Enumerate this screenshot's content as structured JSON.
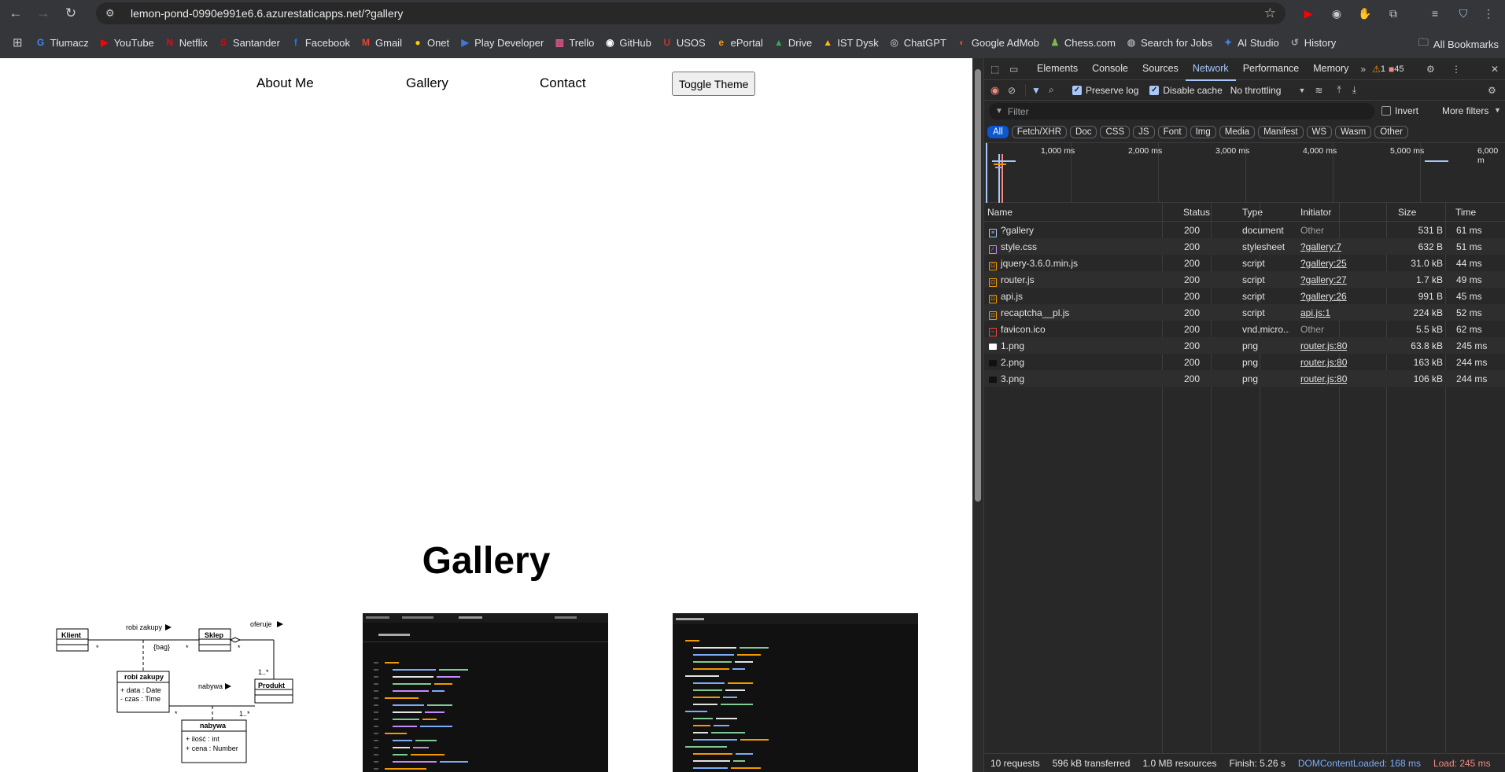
{
  "browser": {
    "url": "lemon-pond-0990e991e6.6.azurestaticapps.net/?gallery",
    "bookmarks": [
      {
        "label": "Tłumacz",
        "color": "#4285f4",
        "glyph": "G"
      },
      {
        "label": "YouTube",
        "color": "#ff0000",
        "glyph": "▶"
      },
      {
        "label": "Netflix",
        "color": "#e50914",
        "glyph": "N"
      },
      {
        "label": "Santander",
        "color": "#ec0000",
        "glyph": "S"
      },
      {
        "label": "Facebook",
        "color": "#1877f2",
        "glyph": "f"
      },
      {
        "label": "Gmail",
        "color": "#ea4335",
        "glyph": "M"
      },
      {
        "label": "Onet",
        "color": "#ffcc00",
        "glyph": "●"
      },
      {
        "label": "Play Developer",
        "color": "#3c78d8",
        "glyph": "▶"
      },
      {
        "label": "Trello",
        "color": "#f05a8e",
        "glyph": "▥"
      },
      {
        "label": "GitHub",
        "color": "#ffffff",
        "glyph": "◉"
      },
      {
        "label": "USOS",
        "color": "#c0392b",
        "glyph": "U"
      },
      {
        "label": "ePortal",
        "color": "#f39c12",
        "glyph": "e"
      },
      {
        "label": "Drive",
        "color": "#34a853",
        "glyph": "▲"
      },
      {
        "label": "IST Dysk",
        "color": "#fbbc04",
        "glyph": "▲"
      },
      {
        "label": "ChatGPT",
        "color": "#9aa0a6",
        "glyph": "◎"
      },
      {
        "label": "Google AdMob",
        "color": "#ea4335",
        "glyph": "◐"
      },
      {
        "label": "Chess.com",
        "color": "#81b64c",
        "glyph": "♟"
      },
      {
        "label": "Search for Jobs",
        "color": "#9aa0a6",
        "glyph": "◍"
      },
      {
        "label": "AI Studio",
        "color": "#4285f4",
        "glyph": "✦"
      },
      {
        "label": "History",
        "color": "#9aa0a6",
        "glyph": "↺"
      }
    ],
    "all_bookmarks": "All Bookmarks"
  },
  "page": {
    "nav": {
      "about": "About Me",
      "gallery": "Gallery",
      "contact": "Contact"
    },
    "toggle_theme": "Toggle Theme",
    "gallery_title": "Gallery",
    "uml": {
      "klient": "Klient",
      "sklep": "Sklep",
      "produkt": "Produkt",
      "robi_zakupy_class": "robi zakupy",
      "nabywa_class": "nabywa",
      "robi_zakupy_label": "robi zakupy",
      "oferuje": "oferuje",
      "nabywa_label": "nabywa",
      "bag": "{bag}",
      "star": "*",
      "one_many": "1..*",
      "attr_data": "+ data : Date",
      "attr_czas": "- czas : Time",
      "attr_ilosc": "+ ilość : int",
      "attr_cena": "+ cena : Number"
    }
  },
  "devtools": {
    "tabs": [
      "Elements",
      "Console",
      "Sources",
      "Network",
      "Performance",
      "Memory"
    ],
    "active_tab": "Network",
    "warnings": "1",
    "errors": "45",
    "preserve_log": "Preserve log",
    "disable_cache": "Disable cache",
    "throttling": "No throttling",
    "filter_placeholder": "Filter",
    "invert": "Invert",
    "more_filters": "More filters",
    "type_filters": [
      "All",
      "Fetch/XHR",
      "Doc",
      "CSS",
      "JS",
      "Font",
      "Img",
      "Media",
      "Manifest",
      "WS",
      "Wasm",
      "Other"
    ],
    "timeline_ticks": [
      "1,000 ms",
      "2,000 ms",
      "3,000 ms",
      "4,000 ms",
      "5,000 ms",
      "6,000 m"
    ],
    "columns": {
      "name": "Name",
      "status": "Status",
      "type": "Type",
      "initiator": "Initiator",
      "size": "Size",
      "time": "Time"
    },
    "requests": [
      {
        "name": "?gallery",
        "status": "200",
        "type": "document",
        "initiator": "Other",
        "initiator_link": false,
        "size": "531 B",
        "time": "61 ms",
        "icon": "doc",
        "color": "#a8c7fa"
      },
      {
        "name": "style.css",
        "status": "200",
        "type": "stylesheet",
        "initiator": "?gallery:7",
        "initiator_link": true,
        "size": "632 B",
        "time": "51 ms",
        "icon": "css",
        "color": "#c58af9"
      },
      {
        "name": "jquery-3.6.0.min.js",
        "status": "200",
        "type": "script",
        "initiator": "?gallery:25",
        "initiator_link": true,
        "size": "31.0 kB",
        "time": "44 ms",
        "icon": "js",
        "color": "#f29900"
      },
      {
        "name": "router.js",
        "status": "200",
        "type": "script",
        "initiator": "?gallery:27",
        "initiator_link": true,
        "size": "1.7 kB",
        "time": "49 ms",
        "icon": "js",
        "color": "#f29900"
      },
      {
        "name": "api.js",
        "status": "200",
        "type": "script",
        "initiator": "?gallery:26",
        "initiator_link": true,
        "size": "991 B",
        "time": "45 ms",
        "icon": "js",
        "color": "#f29900"
      },
      {
        "name": "recaptcha__pl.js",
        "status": "200",
        "type": "script",
        "initiator": "api.js:1",
        "initiator_link": true,
        "size": "224 kB",
        "time": "52 ms",
        "icon": "js",
        "color": "#f29900"
      },
      {
        "name": "favicon.ico",
        "status": "200",
        "type": "vnd.micro...",
        "initiator": "Other",
        "initiator_link": false,
        "size": "5.5 kB",
        "time": "62 ms",
        "icon": "ico",
        "color": "#e8453c"
      },
      {
        "name": "1.png",
        "status": "200",
        "type": "png",
        "initiator": "router.js:80",
        "initiator_link": true,
        "size": "63.8 kB",
        "time": "245 ms",
        "icon": "img",
        "color": "#ffffff"
      },
      {
        "name": "2.png",
        "status": "200",
        "type": "png",
        "initiator": "router.js:80",
        "initiator_link": true,
        "size": "163 kB",
        "time": "244 ms",
        "icon": "img",
        "color": "#111111"
      },
      {
        "name": "3.png",
        "status": "200",
        "type": "png",
        "initiator": "router.js:80",
        "initiator_link": true,
        "size": "106 kB",
        "time": "244 ms",
        "icon": "img",
        "color": "#111111"
      }
    ],
    "status": {
      "requests": "10 requests",
      "transferred": "596 kB transferred",
      "resources": "1.0 MB resources",
      "finish": "Finish: 5.26 s",
      "dcl": "DOMContentLoaded: 168 ms",
      "load": "Load: 245 ms"
    }
  }
}
